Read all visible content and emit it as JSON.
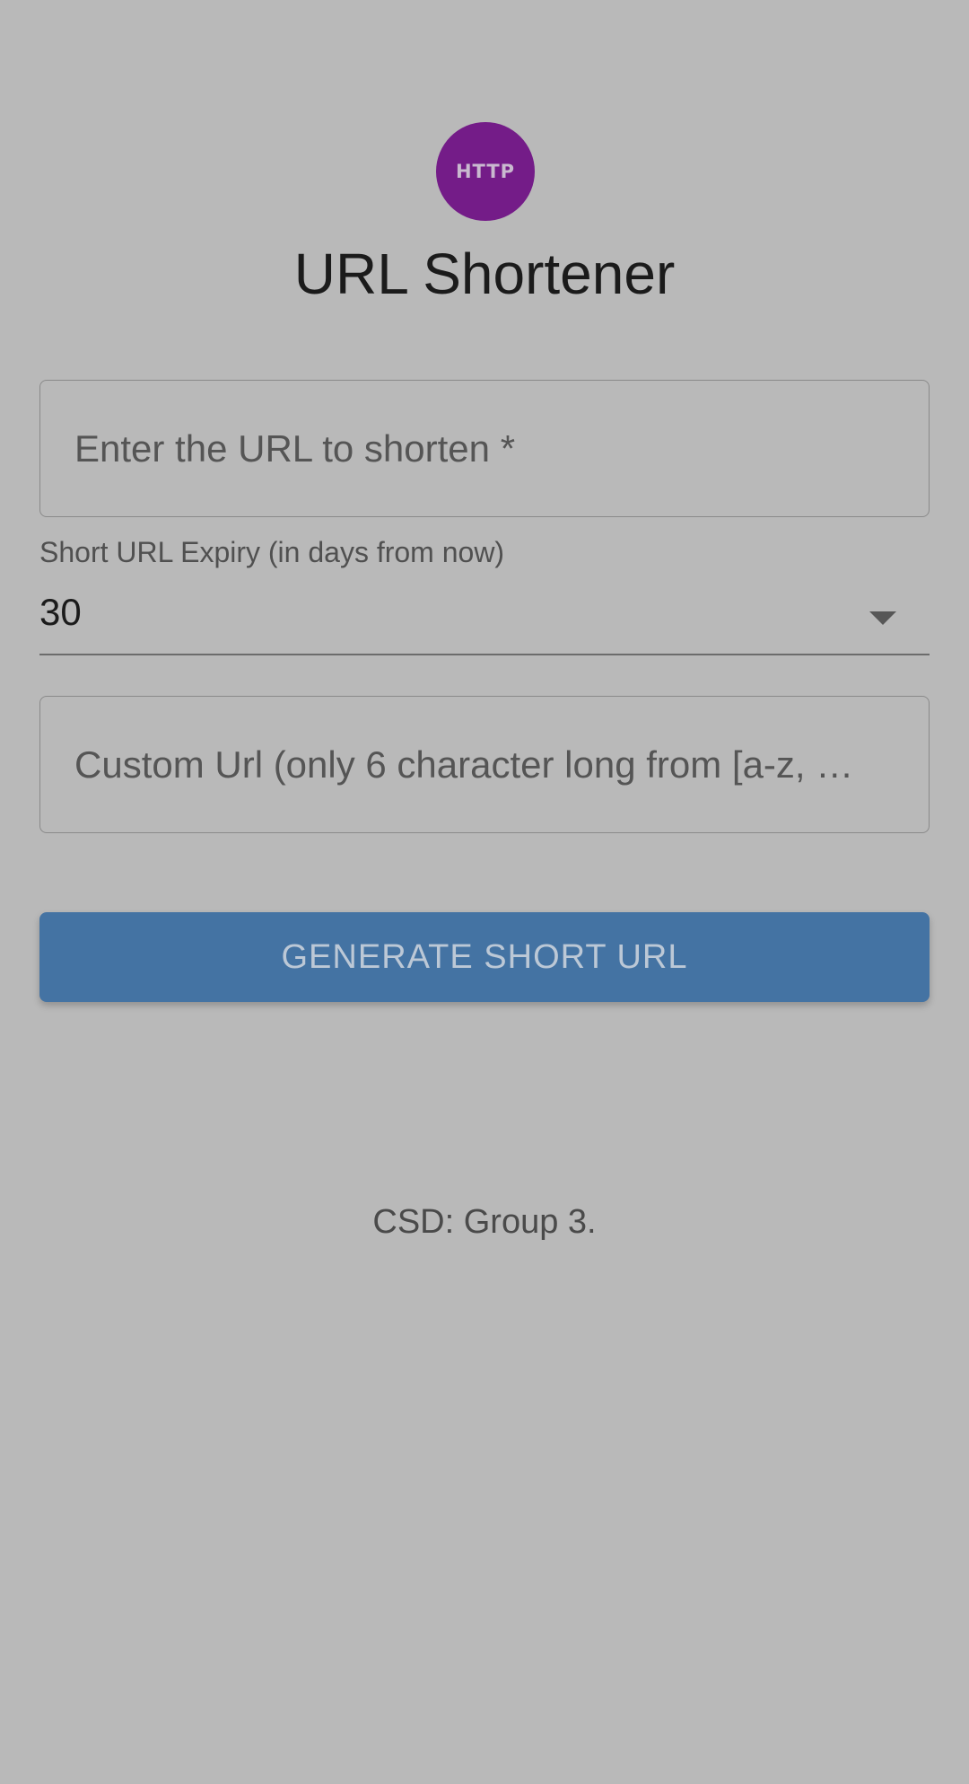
{
  "logo": {
    "text": "HTTP",
    "icon": "http-logo-icon",
    "color": "#741c88"
  },
  "page": {
    "title": "URL Shortener"
  },
  "form": {
    "url_field": {
      "placeholder": "Enter the URL to shorten *",
      "value": ""
    },
    "expiry": {
      "label": "Short URL Expiry (in days from now)",
      "selected": "30",
      "icon": "dropdown-arrow-icon"
    },
    "custom_field": {
      "placeholder": "Custom Url (only 6 character long from [a-z, …",
      "value": ""
    },
    "submit_label": "GENERATE SHORT URL"
  },
  "footer": {
    "text": "CSD: Group 3."
  },
  "colors": {
    "background": "#b9b9b9",
    "button": "#4473a3",
    "logo": "#741c88"
  }
}
